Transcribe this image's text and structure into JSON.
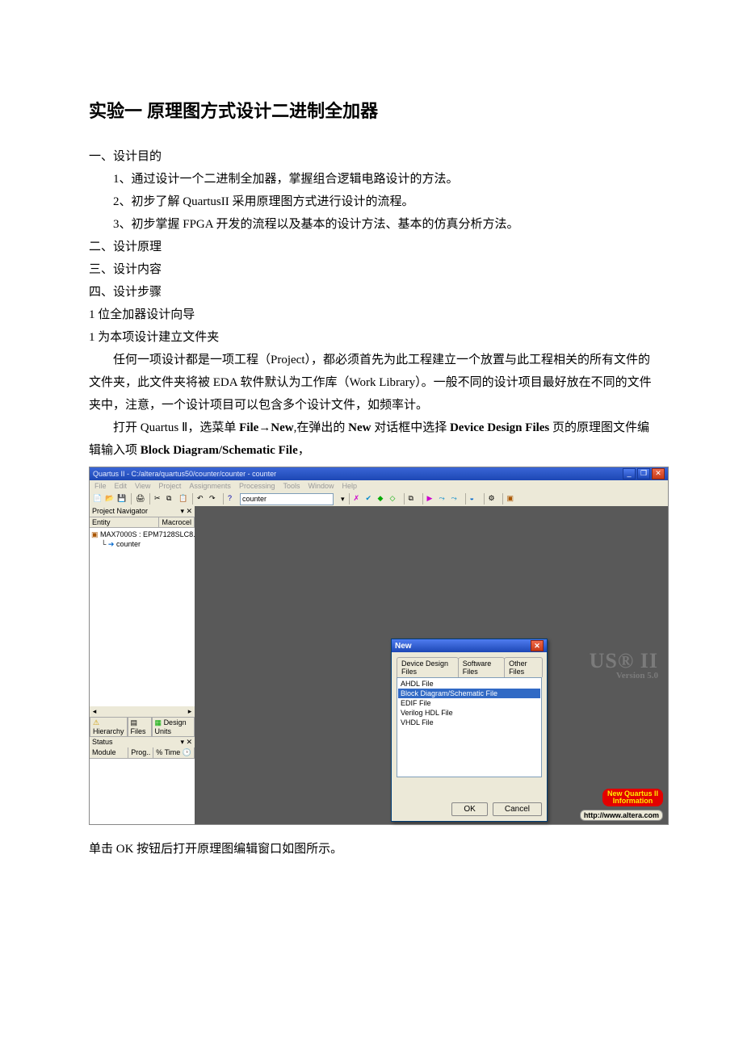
{
  "doc": {
    "title": "实验一  原理图方式设计二进制全加器",
    "sec1": "一、设计目的",
    "p1": "1、通过设计一个二进制全加器，掌握组合逻辑电路设计的方法。",
    "p2": "2、初步了解 QuartusII 采用原理图方式进行设计的流程。",
    "p3": "3、初步掌握 FPGA 开发的流程以及基本的设计方法、基本的仿真分析方法。",
    "sec2": "二、设计原理",
    "sec3": "三、设计内容",
    "sec4": "四、设计步骤",
    "step1": "1 位全加器设计向导",
    "step2": "1  为本项设计建立文件夹",
    "para1": "任何一项设计都是一项工程（Project），都必须首先为此工程建立一个放置与此工程相关的所有文件的文件夹，此文件夹将被 EDA 软件默认为工作库（Work Library）。一般不同的设计项目最好放在不同的文件夹中，注意，一个设计项目可以包含多个设计文件，如频率计。",
    "para2a": "打开 Quartus  Ⅱ，选菜单 ",
    "para2b_file": "File",
    "para2b_arrow": "→",
    "para2b_new": "New",
    "para2c": ",在弹出的 ",
    "para2d_new2": "New",
    "para2e": " 对话框中选择 ",
    "para2f_ddf": "Device Design Files",
    "para2g": " 页的原理图文件编辑输入项 ",
    "para2h_bdsf": "Block Diagram/Schematic File",
    "para2i": "，",
    "after_img": "单击 OK 按钮后打开原理图编辑窗口如图所示。"
  },
  "quartus": {
    "titlebar": "Quartus II - C:/altera/quartus50/counter/counter - counter",
    "menus": [
      "File",
      "Edit",
      "View",
      "Project",
      "Assignments",
      "Processing",
      "Tools",
      "Window",
      "Help"
    ],
    "combobox": "counter",
    "project_navigator": "Project Navigator",
    "col_entity": "Entity",
    "col_macrocel": "Macrocel",
    "device": "MAX7000S : EPM7128SLC8...",
    "entity": "counter",
    "tab_hierarchy": "Hierarchy",
    "tab_files": "Files",
    "tab_design_units": "Design Units",
    "status": "Status",
    "col_module": "Module",
    "col_prog": "Prog..",
    "col_time": "% Time",
    "brand_big": "US® II",
    "brand_ver": "Version 5.0",
    "redbadge_line1": "New Quartus II",
    "redbadge_line2": "Information",
    "url": "http://www.altera.com"
  },
  "newdlg": {
    "title": "New",
    "tabs": [
      "Device Design Files",
      "Software Files",
      "Other Files"
    ],
    "items": [
      "AHDL File",
      "Block Diagram/Schematic File",
      "EDIF File",
      "Verilog HDL File",
      "VHDL File"
    ],
    "selected_index": 1,
    "ok": "OK",
    "cancel": "Cancel"
  }
}
